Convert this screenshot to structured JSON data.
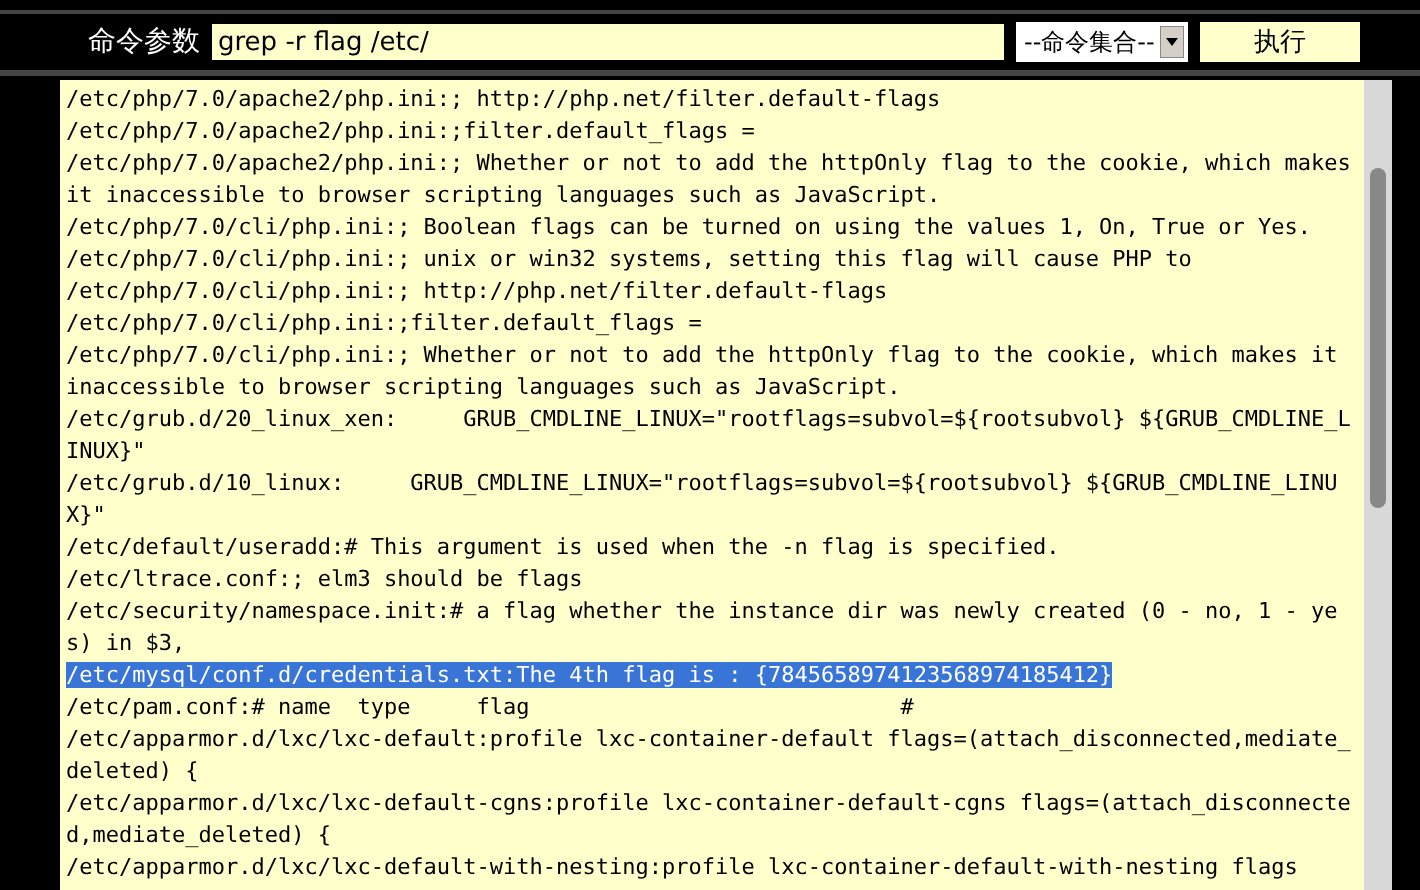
{
  "toolbar": {
    "label": "命令参数",
    "command_field": {
      "value": "grep -r flag /etc/"
    },
    "command_set_dropdown": {
      "value": "--命令集合--"
    },
    "execute_button": "执行"
  },
  "output": {
    "lines": [
      {
        "text": "/etc/php/7.0/apache2/php.ini:; http://php.net/filter.default-flags",
        "selected": false
      },
      {
        "text": "/etc/php/7.0/apache2/php.ini:;filter.default_flags =",
        "selected": false
      },
      {
        "text": "/etc/php/7.0/apache2/php.ini:; Whether or not to add the httpOnly flag to the cookie, which makes it inaccessible to browser scripting languages such as JavaScript.",
        "selected": false
      },
      {
        "text": "/etc/php/7.0/cli/php.ini:; Boolean flags can be turned on using the values 1, On, True or Yes.",
        "selected": false
      },
      {
        "text": "/etc/php/7.0/cli/php.ini:; unix or win32 systems, setting this flag will cause PHP to",
        "selected": false
      },
      {
        "text": "/etc/php/7.0/cli/php.ini:; http://php.net/filter.default-flags",
        "selected": false
      },
      {
        "text": "/etc/php/7.0/cli/php.ini:;filter.default_flags =",
        "selected": false
      },
      {
        "text": "/etc/php/7.0/cli/php.ini:; Whether or not to add the httpOnly flag to the cookie, which makes it inaccessible to browser scripting languages such as JavaScript.",
        "selected": false
      },
      {
        "text": "/etc/grub.d/20_linux_xen:     GRUB_CMDLINE_LINUX=\"rootflags=subvol=${rootsubvol} ${GRUB_CMDLINE_LINUX}\"",
        "selected": false
      },
      {
        "text": "/etc/grub.d/10_linux:     GRUB_CMDLINE_LINUX=\"rootflags=subvol=${rootsubvol} ${GRUB_CMDLINE_LINUX}\"",
        "selected": false
      },
      {
        "text": "/etc/default/useradd:# This argument is used when the -n flag is specified.",
        "selected": false
      },
      {
        "text": "/etc/ltrace.conf:; elm3 should be flags",
        "selected": false
      },
      {
        "text": "/etc/security/namespace.init:# a flag whether the instance dir was newly created (0 - no, 1 - yes) in $3,",
        "selected": false
      },
      {
        "text": "/etc/mysql/conf.d/credentials.txt:The 4th flag is : {7845658974123568974185412}",
        "selected": true
      },
      {
        "text": "/etc/pam.conf:# name  type     flag                            #",
        "selected": false
      },
      {
        "text": "/etc/apparmor.d/lxc/lxc-default:profile lxc-container-default flags=(attach_disconnected,mediate_deleted) {",
        "selected": false
      },
      {
        "text": "/etc/apparmor.d/lxc/lxc-default-cgns:profile lxc-container-default-cgns flags=(attach_disconnected,mediate_deleted) {",
        "selected": false
      },
      {
        "text": "/etc/apparmor.d/lxc/lxc-default-with-nesting:profile lxc-container-default-with-nesting flags",
        "selected": false
      }
    ]
  }
}
